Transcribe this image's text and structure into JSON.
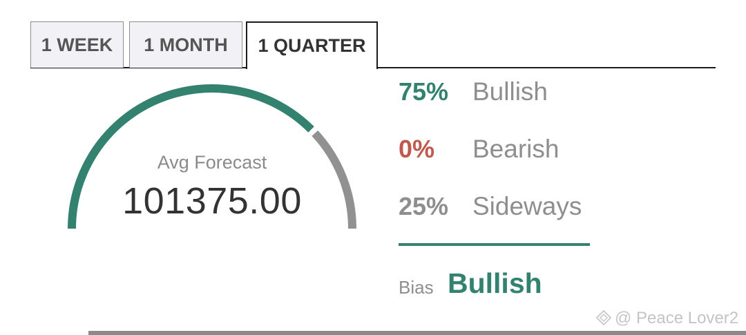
{
  "tabs": [
    {
      "label": "1 WEEK",
      "active": false
    },
    {
      "label": "1 MONTH",
      "active": false
    },
    {
      "label": "1 QUARTER",
      "active": true
    }
  ],
  "gauge": {
    "caption": "Avg Forecast",
    "value": "101375.00",
    "fill_fraction": 0.75,
    "fill_color": "#338270",
    "rest_color": "#919191"
  },
  "stats": {
    "bullish": {
      "percent": "75%",
      "label": "Bullish",
      "color": "#338270"
    },
    "bearish": {
      "percent": "0%",
      "label": "Bearish",
      "color": "#c0584e"
    },
    "sideways": {
      "percent": "25%",
      "label": "Sideways",
      "color": "#8e8e8e"
    }
  },
  "divider_color": "#338270",
  "bias": {
    "label": "Bias",
    "value": "Bullish",
    "color": "#338270"
  },
  "watermark": {
    "text": "@ Peace Lover2",
    "icon": "diamond-logo-icon"
  }
}
